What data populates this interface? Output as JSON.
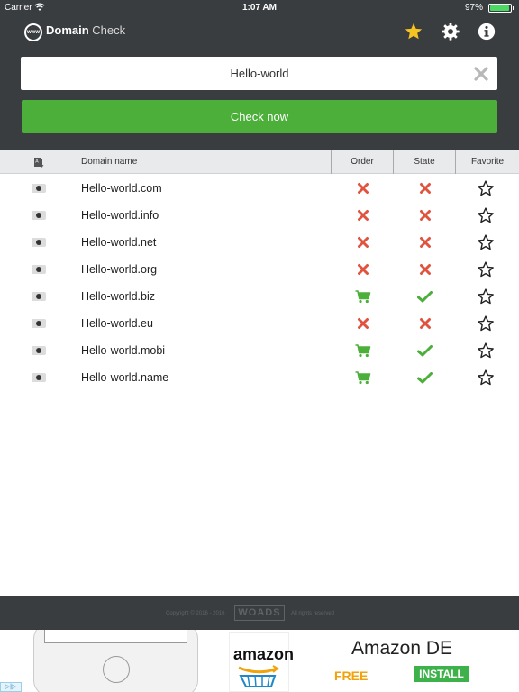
{
  "status_bar": {
    "carrier": "Carrier",
    "time": "1:07 AM",
    "battery_percent": "97%",
    "battery_level": 0.97
  },
  "header": {
    "logo_text": "www",
    "title_bold": "Domain",
    "title_light": " Check",
    "accent_color": "#4caf3a",
    "star_color": "#f5c423"
  },
  "search": {
    "value": "Hello-world",
    "button_label": "Check now"
  },
  "table": {
    "columns": {
      "domain": "Domain name",
      "order": "Order",
      "state": "State",
      "favorite": "Favorite"
    },
    "rows": [
      {
        "domain": "Hello-world.com",
        "order": "unavailable",
        "state": "taken",
        "favorite": false
      },
      {
        "domain": "Hello-world.info",
        "order": "unavailable",
        "state": "taken",
        "favorite": false
      },
      {
        "domain": "Hello-world.net",
        "order": "unavailable",
        "state": "taken",
        "favorite": false
      },
      {
        "domain": "Hello-world.org",
        "order": "unavailable",
        "state": "taken",
        "favorite": false
      },
      {
        "domain": "Hello-world.biz",
        "order": "cart",
        "state": "available",
        "favorite": false
      },
      {
        "domain": "Hello-world.eu",
        "order": "unavailable",
        "state": "taken",
        "favorite": false
      },
      {
        "domain": "Hello-world.mobi",
        "order": "cart",
        "state": "available",
        "favorite": false
      },
      {
        "domain": "Hello-world.name",
        "order": "cart",
        "state": "available",
        "favorite": false
      }
    ]
  },
  "footer": {
    "copyright": "Copyright © 2016 - 2016",
    "brand": "WOADS",
    "rights": "All rights reserved"
  },
  "ad": {
    "adchoices": "▷|▷",
    "logo_word": "amazon",
    "title": "Amazon DE",
    "price": "FREE",
    "cta": "INSTALL"
  }
}
